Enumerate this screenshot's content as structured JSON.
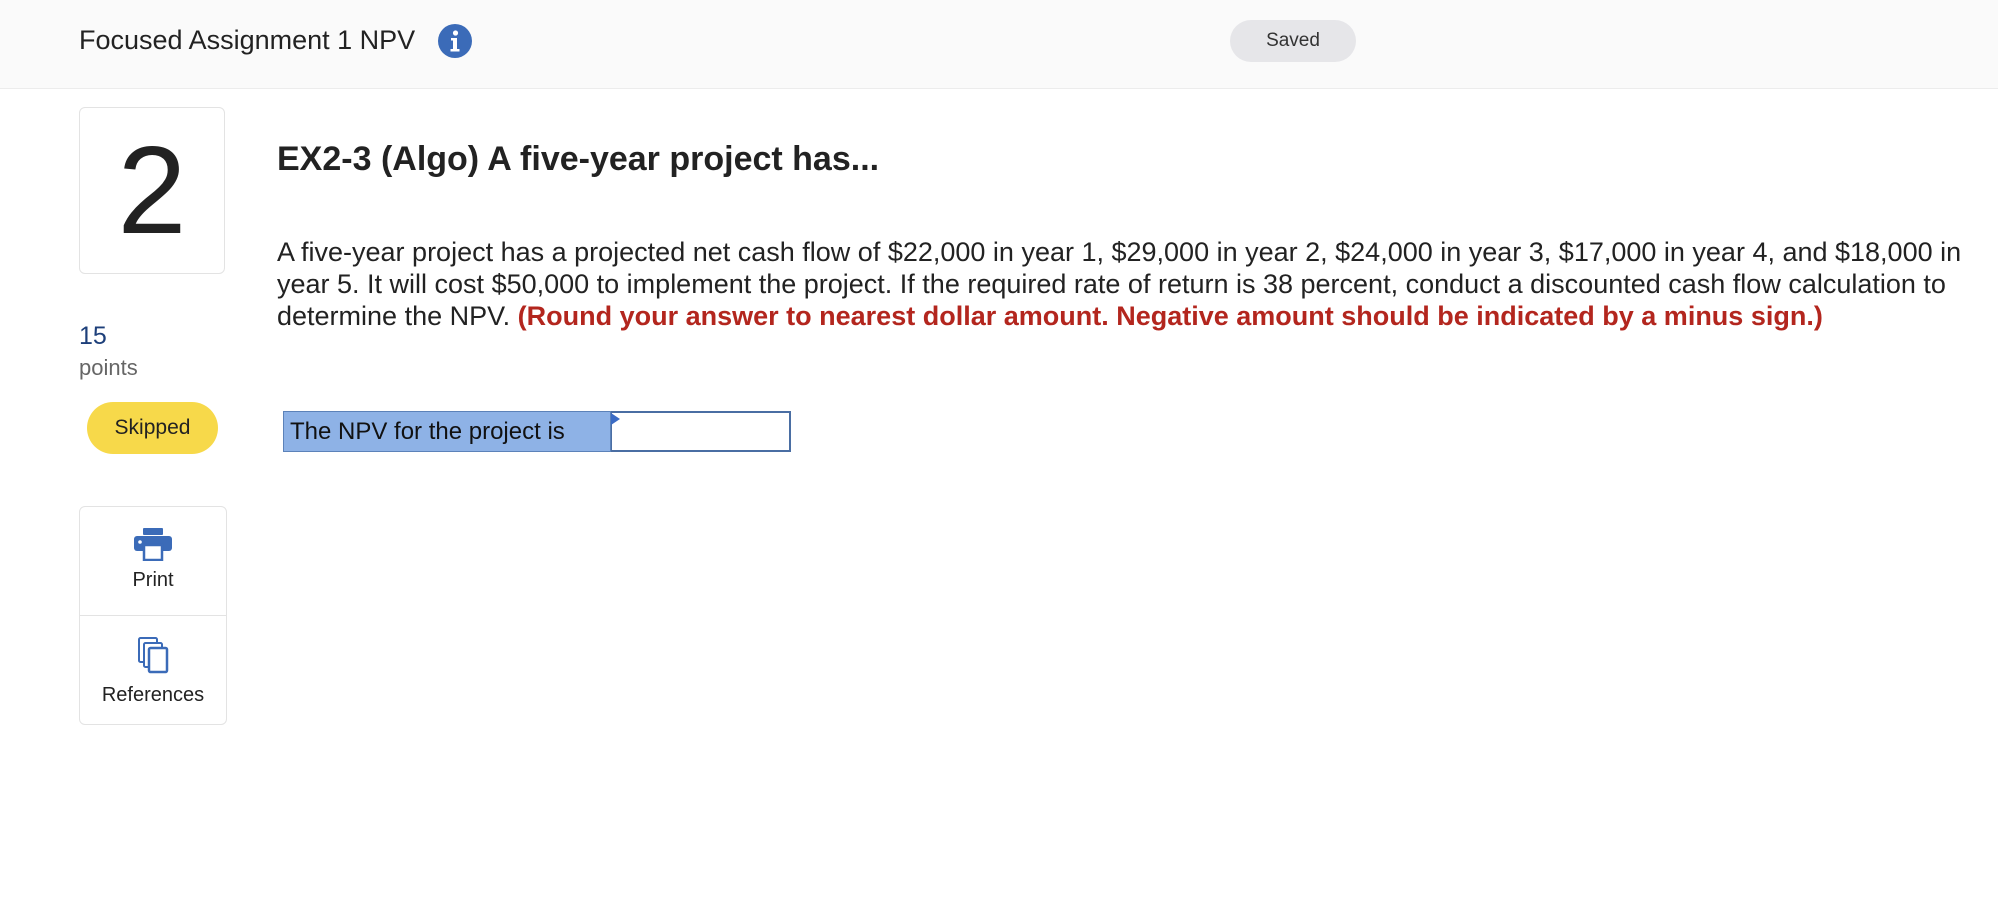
{
  "header": {
    "assignment_title": "Focused Assignment 1 NPV",
    "info_icon": "info-icon",
    "save_status": "Saved"
  },
  "question": {
    "number": "2",
    "points_value": "15",
    "points_label": "points",
    "status": "Skipped",
    "title": "EX2-3 (Algo) A five-year project has...",
    "body": "A five-year project has a projected net cash flow of $22,000 in year 1, $29,000 in year 2, $24,000 in year 3, $17,000 in year 4, and $18,000 in year 5. It will cost $50,000 to implement the project. If the required rate of return is 38 percent, conduct a discounted cash flow calculation to determine the NPV.",
    "hint": "(Round your answer to nearest dollar amount. Negative amount should be indicated by a minus sign.)",
    "answer_label": "The NPV for the project is",
    "answer_value": ""
  },
  "tools": {
    "print_label": "Print",
    "print_icon": "printer-icon",
    "references_label": "References",
    "references_icon": "documents-icon"
  },
  "colors": {
    "info_icon": "#3b6bb8",
    "status_badge": "#f7d94a",
    "hint_text": "#b3261e",
    "answer_label_bg": "#8eb2e6",
    "points_value": "#1d3f7a"
  }
}
